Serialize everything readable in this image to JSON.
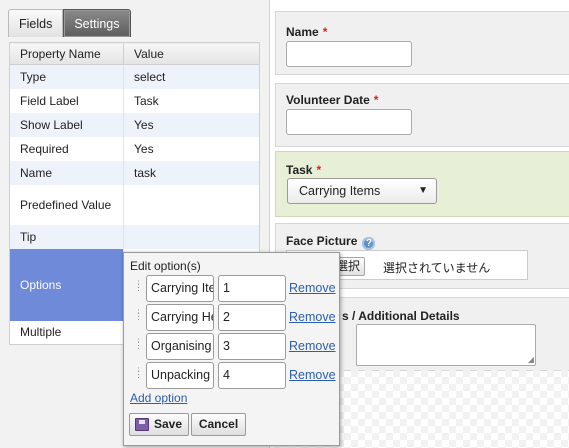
{
  "tabs": [
    {
      "label": "Fields"
    },
    {
      "label": "Settings"
    }
  ],
  "property_table": {
    "headers": [
      "Property Name",
      "Value"
    ],
    "rows": [
      {
        "name": "Type",
        "value": "select"
      },
      {
        "name": "Field Label",
        "value": "Task"
      },
      {
        "name": "Show Label",
        "value": "Yes"
      },
      {
        "name": "Required",
        "value": "Yes"
      },
      {
        "name": "Name",
        "value": "task"
      },
      {
        "name": "Predefined Value",
        "value": ""
      },
      {
        "name": "Tip",
        "value": ""
      },
      {
        "name": "Options",
        "value": ""
      },
      {
        "name": "Multiple",
        "value": ""
      }
    ]
  },
  "form": {
    "name": {
      "label": "Name",
      "required": "*"
    },
    "volunteer_date": {
      "label": "Volunteer Date",
      "required": "*"
    },
    "task": {
      "label": "Task",
      "required": "*",
      "selected": "Carrying Items",
      "arrow": "▼"
    },
    "face_picture": {
      "label": "Face Picture",
      "help": "?",
      "file_button": "選択",
      "file_status": "選択されていません"
    },
    "notes": {
      "label": "s / Additional Details"
    }
  },
  "option_editor": {
    "title": "Edit option(s)",
    "options": [
      {
        "label": "Carrying Ite",
        "value": "1",
        "remove": "Remove"
      },
      {
        "label": "Carrying He",
        "value": "2",
        "remove": "Remove"
      },
      {
        "label": "Organising",
        "value": "3",
        "remove": "Remove"
      },
      {
        "label": "Unpacking",
        "value": "4",
        "remove": "Remove"
      }
    ],
    "add_option": "Add option",
    "save": "Save",
    "cancel": "Cancel"
  },
  "colors": {
    "selected_row": "#6e8ad8",
    "task_field_bg": "#e7efd7",
    "link": "#2b5db2",
    "required": "#d62222"
  }
}
